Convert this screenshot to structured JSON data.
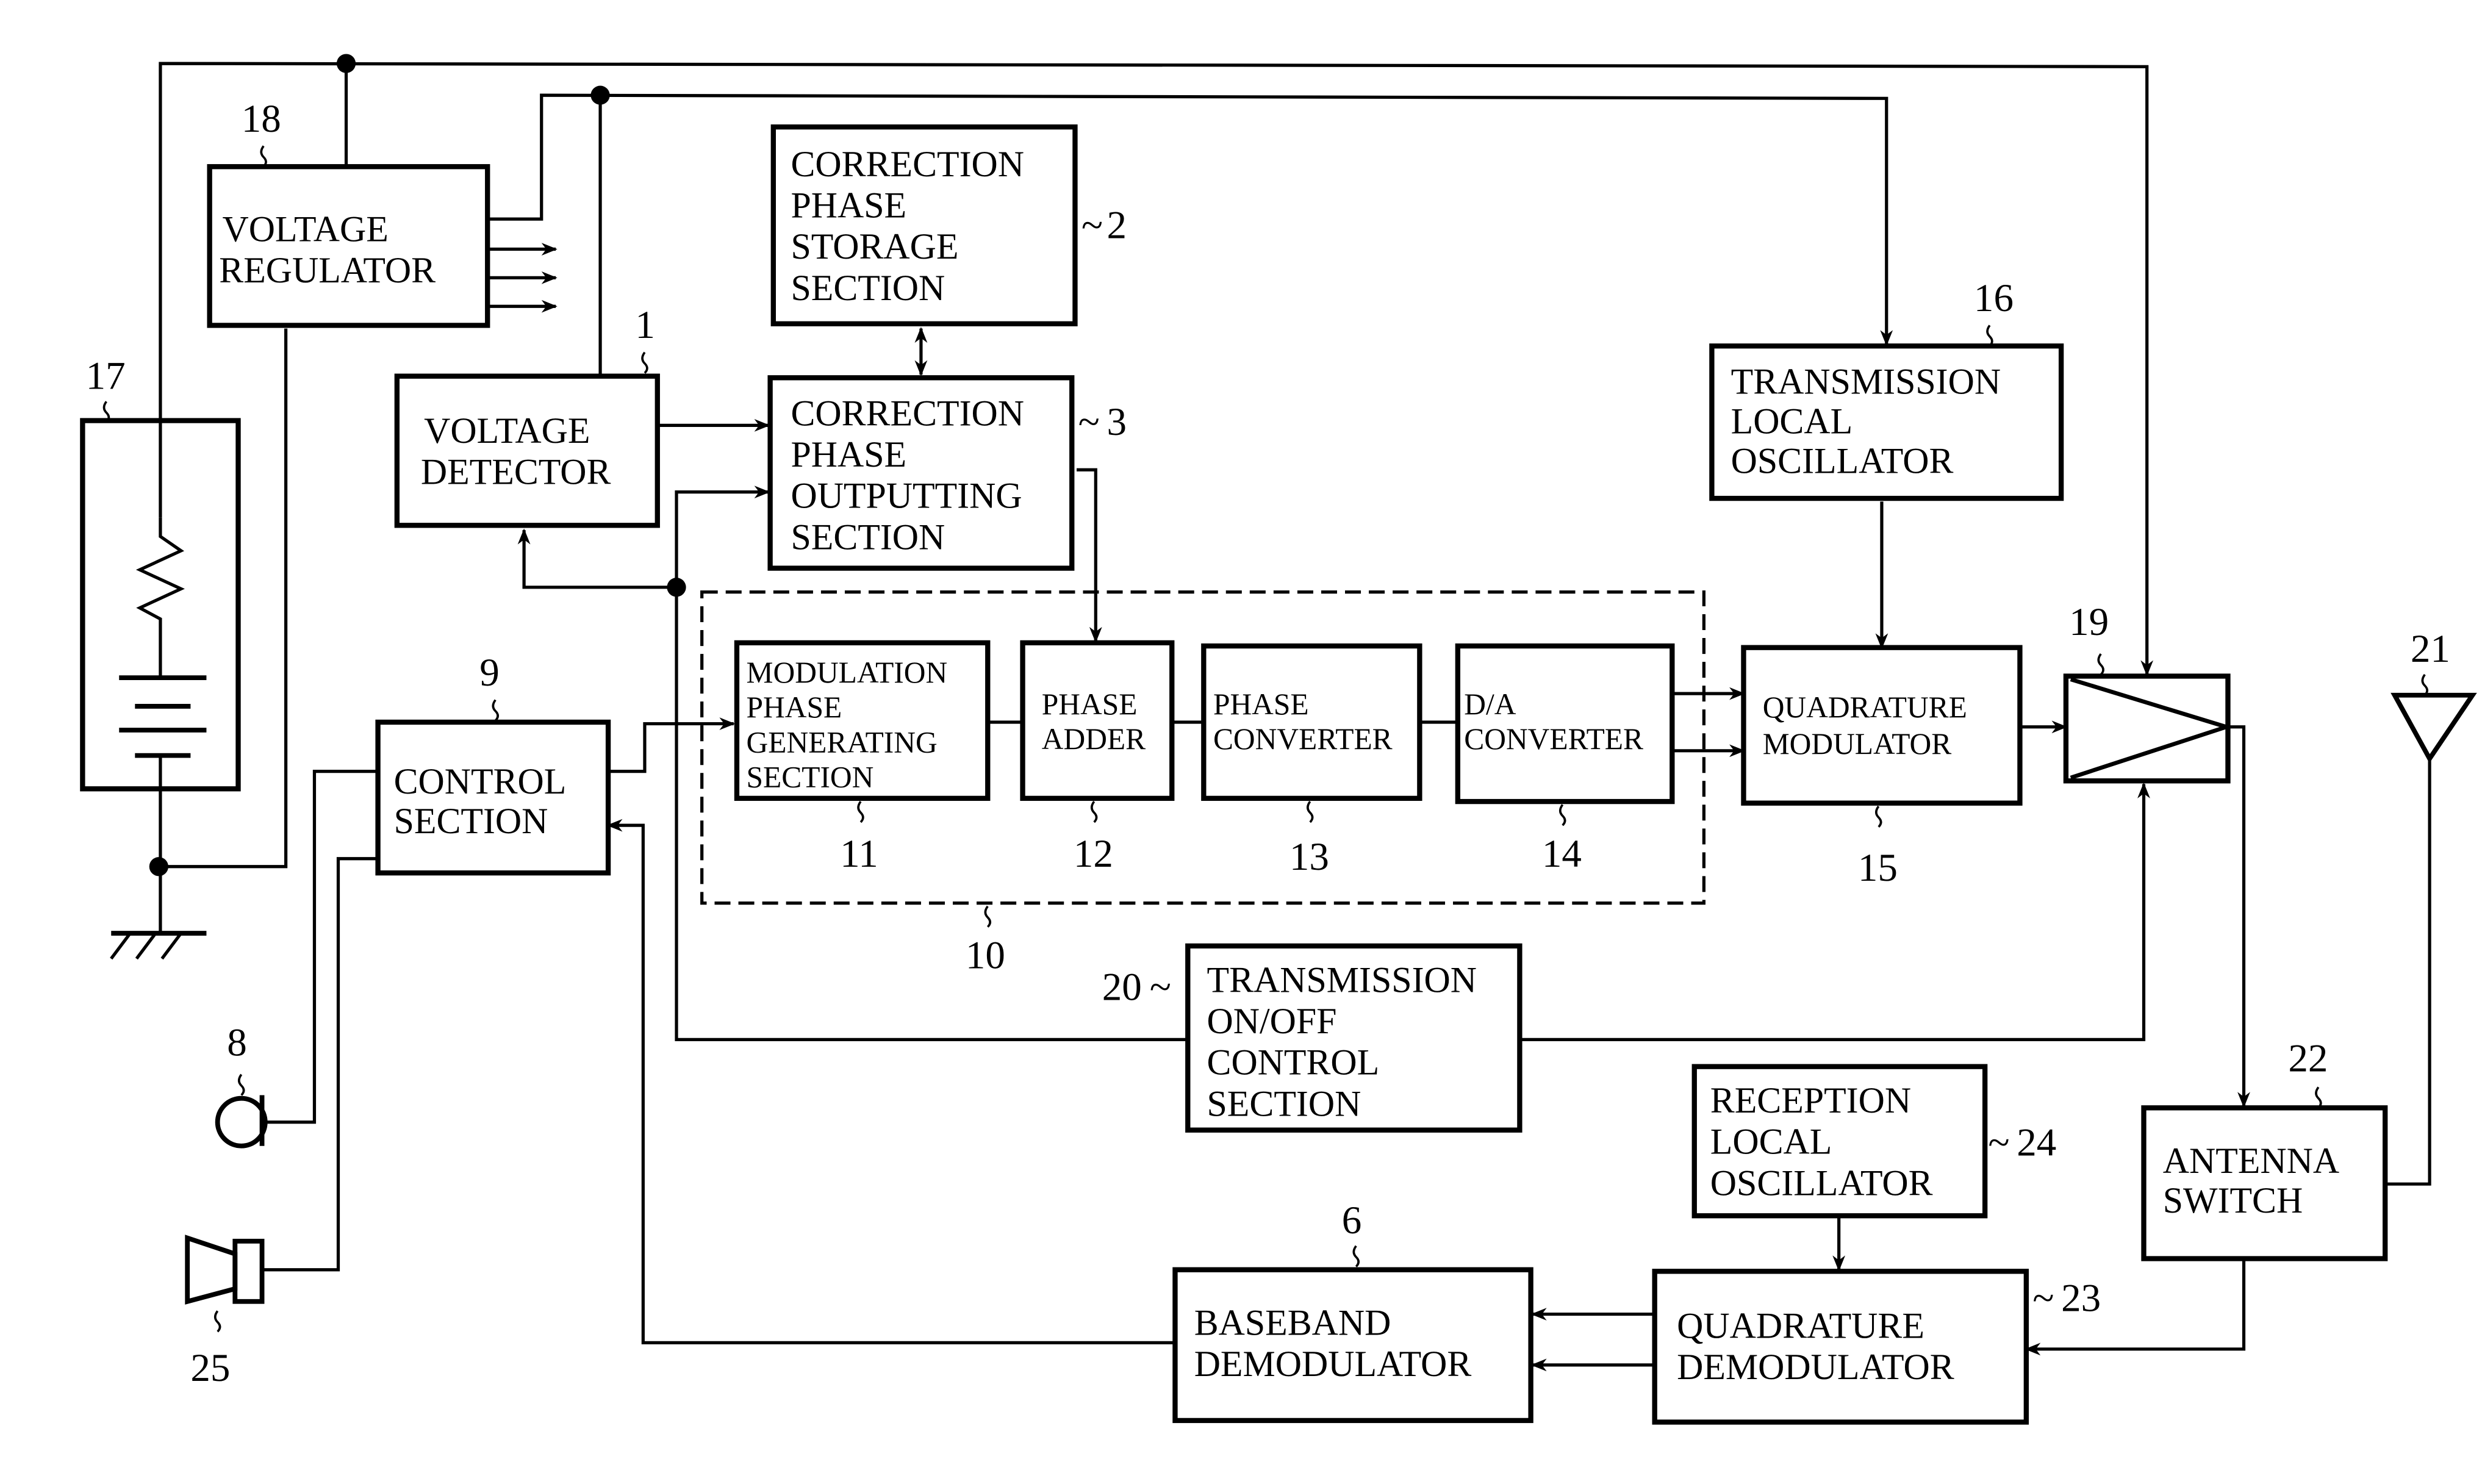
{
  "figure": {
    "blocks": {
      "voltage_detector": {
        "ref": "1",
        "lines": [
          "VOLTAGE",
          "DETECTOR"
        ]
      },
      "correction_phase_storage": {
        "ref": "2",
        "lines": [
          "CORRECTION",
          "PHASE",
          "STORAGE",
          "SECTION"
        ]
      },
      "correction_phase_outputting": {
        "ref": "3",
        "lines": [
          "CORRECTION",
          "PHASE",
          "OUTPUTTING",
          "SECTION"
        ]
      },
      "baseband_demodulator": {
        "ref": "6",
        "lines": [
          "BASEBAND",
          "DEMODULATOR"
        ]
      },
      "microphone": {
        "ref": "8"
      },
      "control_section": {
        "ref": "9",
        "lines": [
          "CONTROL",
          "SECTION"
        ]
      },
      "modulation_group": {
        "ref": "10"
      },
      "modulation_phase_generating": {
        "ref": "11",
        "lines": [
          "MODULATION",
          "PHASE",
          "GENERATING",
          "SECTION"
        ]
      },
      "phase_adder": {
        "ref": "12",
        "lines": [
          "PHASE",
          "ADDER"
        ]
      },
      "phase_converter": {
        "ref": "13",
        "lines": [
          "PHASE",
          "CONVERTER"
        ]
      },
      "da_converter": {
        "ref": "14",
        "lines": [
          "D/A",
          "CONVERTER"
        ]
      },
      "quadrature_modulator": {
        "ref": "15",
        "lines": [
          "QUADRATURE",
          "MODULATOR"
        ]
      },
      "transmission_local_oscillator": {
        "ref": "16",
        "lines": [
          "TRANSMISSION",
          "LOCAL",
          "OSCILLATOR"
        ]
      },
      "battery": {
        "ref": "17"
      },
      "voltage_regulator": {
        "ref": "18",
        "lines": [
          "VOLTAGE",
          "REGULATOR"
        ]
      },
      "power_amplifier": {
        "ref": "19"
      },
      "transmission_onoff_control": {
        "ref": "20",
        "lines": [
          "TRANSMISSION",
          "ON/OFF",
          "CONTROL",
          "SECTION"
        ]
      },
      "antenna": {
        "ref": "21"
      },
      "antenna_switch": {
        "ref": "22",
        "lines": [
          "ANTENNA",
          "SWITCH"
        ]
      },
      "quadrature_demodulator": {
        "ref": "23",
        "lines": [
          "QUADRATURE",
          "DEMODULATOR"
        ]
      },
      "reception_local_oscillator": {
        "ref": "24",
        "lines": [
          "RECEPTION",
          "LOCAL",
          "OSCILLATOR"
        ]
      },
      "speaker": {
        "ref": "25"
      }
    }
  }
}
